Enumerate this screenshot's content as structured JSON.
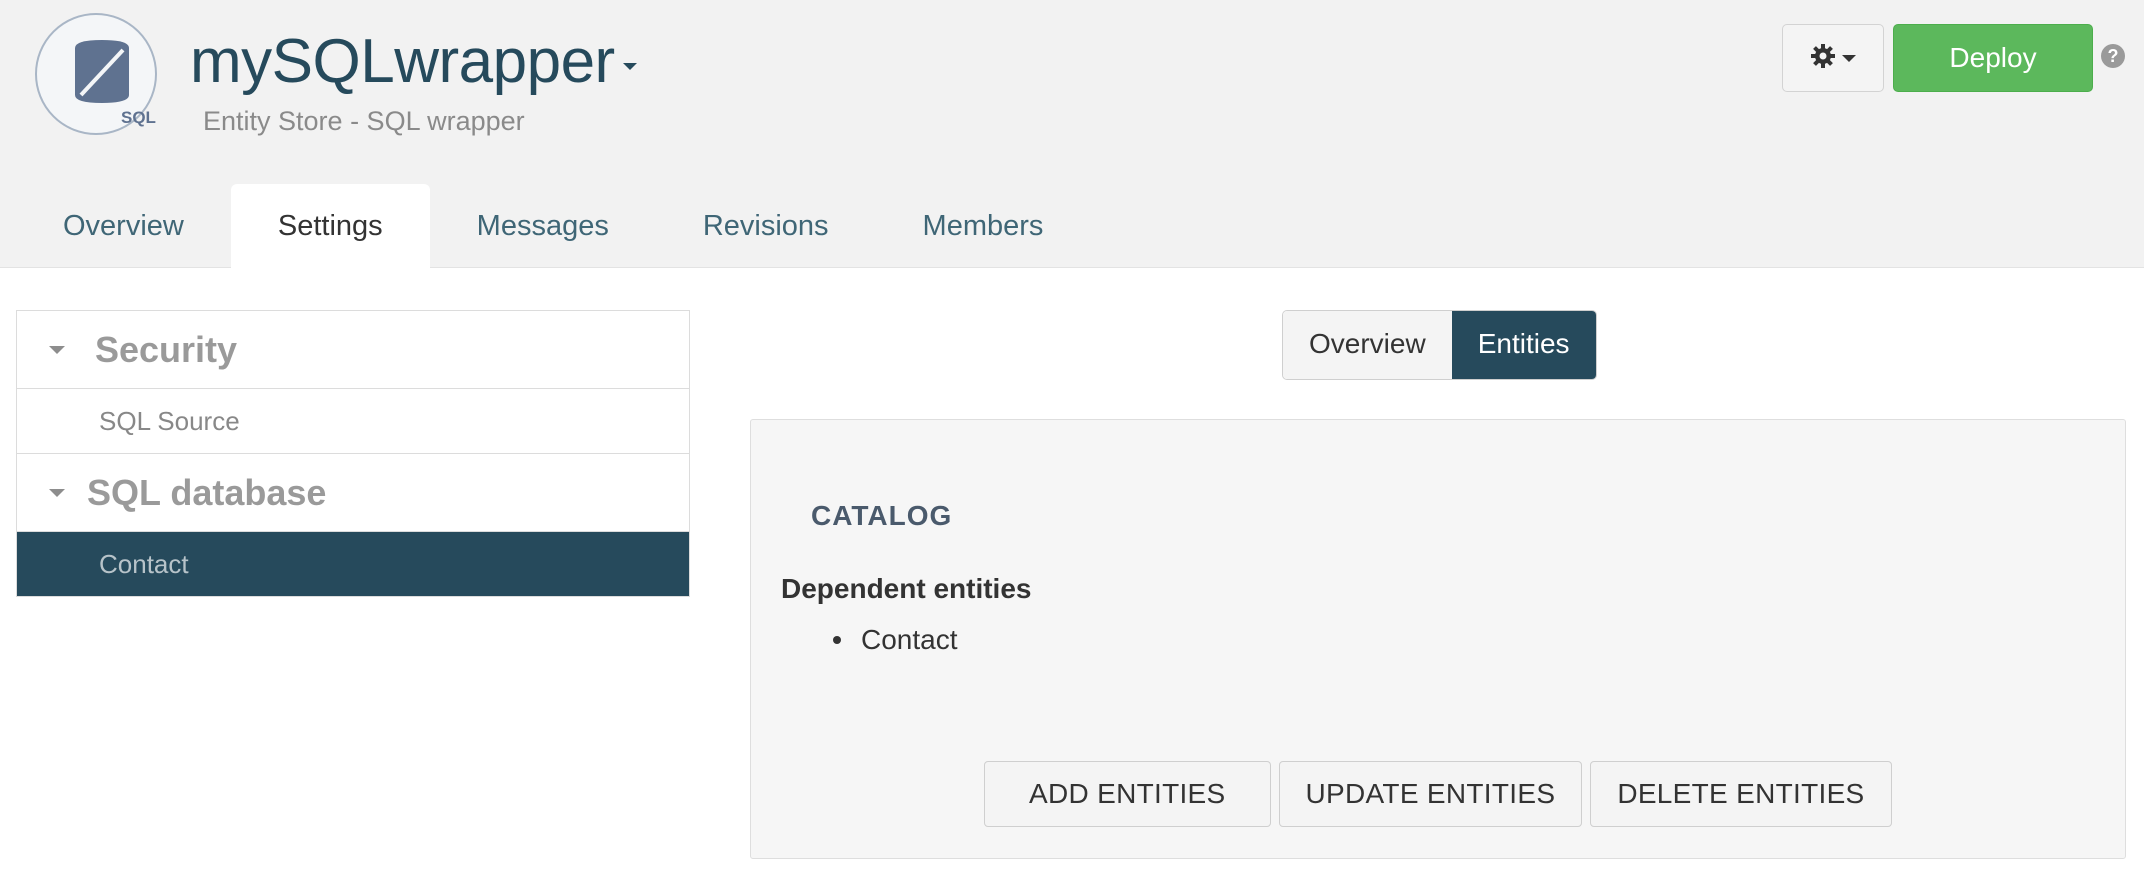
{
  "header": {
    "logo_text": "SQL",
    "app_title": "mySQLwrapper",
    "subtitle": "Entity Store - SQL wrapper",
    "deploy_label": "Deploy",
    "help_symbol": "?"
  },
  "tabs": [
    {
      "label": "Overview",
      "active": false
    },
    {
      "label": "Settings",
      "active": true
    },
    {
      "label": "Messages",
      "active": false
    },
    {
      "label": "Revisions",
      "active": false
    },
    {
      "label": "Members",
      "active": false
    }
  ],
  "sidebar": {
    "groups": [
      {
        "title": "Security",
        "items": [
          {
            "label": "SQL Source",
            "selected": false
          }
        ]
      },
      {
        "title": "SQL database",
        "items": [
          {
            "label": "Contact",
            "selected": true
          }
        ]
      }
    ]
  },
  "view_toggle": {
    "options": [
      {
        "label": "Overview",
        "active": false
      },
      {
        "label": "Entities",
        "active": true
      }
    ]
  },
  "main": {
    "section_title": "CATALOG",
    "dependent_title": "Dependent entities",
    "dependent_entities": [
      "Contact"
    ],
    "buttons": {
      "add": "ADD ENTITIES",
      "update": "UPDATE ENTITIES",
      "delete": "DELETE ENTITIES"
    }
  },
  "colors": {
    "primary_dark": "#264a5c",
    "deploy_green": "#5cb85c",
    "header_bg": "#f2f2f2"
  },
  "icons": {
    "logo": "sql-database-icon",
    "settings": "gear-icon",
    "help": "help-icon"
  }
}
